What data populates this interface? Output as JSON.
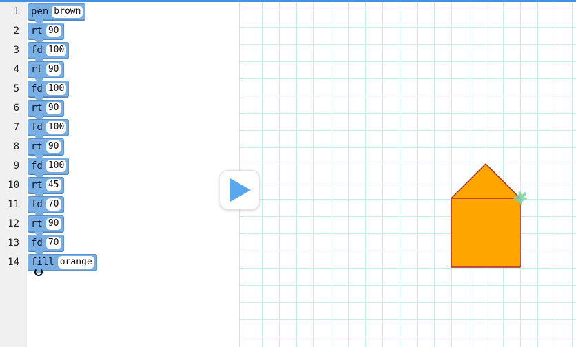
{
  "editor": {
    "lines": [
      {
        "num": "1",
        "kw": "pen",
        "arg": "brown"
      },
      {
        "num": "2",
        "kw": "rt",
        "arg": "90"
      },
      {
        "num": "3",
        "kw": "fd",
        "arg": "100"
      },
      {
        "num": "4",
        "kw": "rt",
        "arg": "90"
      },
      {
        "num": "5",
        "kw": "fd",
        "arg": "100"
      },
      {
        "num": "6",
        "kw": "rt",
        "arg": "90"
      },
      {
        "num": "7",
        "kw": "fd",
        "arg": "100"
      },
      {
        "num": "8",
        "kw": "rt",
        "arg": "90"
      },
      {
        "num": "9",
        "kw": "fd",
        "arg": "100"
      },
      {
        "num": "10",
        "kw": "rt",
        "arg": "45"
      },
      {
        "num": "11",
        "kw": "fd",
        "arg": "70"
      },
      {
        "num": "12",
        "kw": "rt",
        "arg": "90"
      },
      {
        "num": "13",
        "kw": "fd",
        "arg": "70"
      },
      {
        "num": "14",
        "kw": "fill",
        "arg": "orange"
      }
    ]
  },
  "run": {
    "icon": "play-icon"
  },
  "canvas": {
    "pen_color": "brown",
    "fill_color": "orange",
    "turtle_icon": "turtle-icon",
    "colors": {
      "stroke": "#a52a2a",
      "fill": "#ffa500",
      "turtle": "#7fd1a6",
      "grid": "#cdeee6",
      "block": "#79aee3",
      "play": "#5aa7f0"
    }
  }
}
